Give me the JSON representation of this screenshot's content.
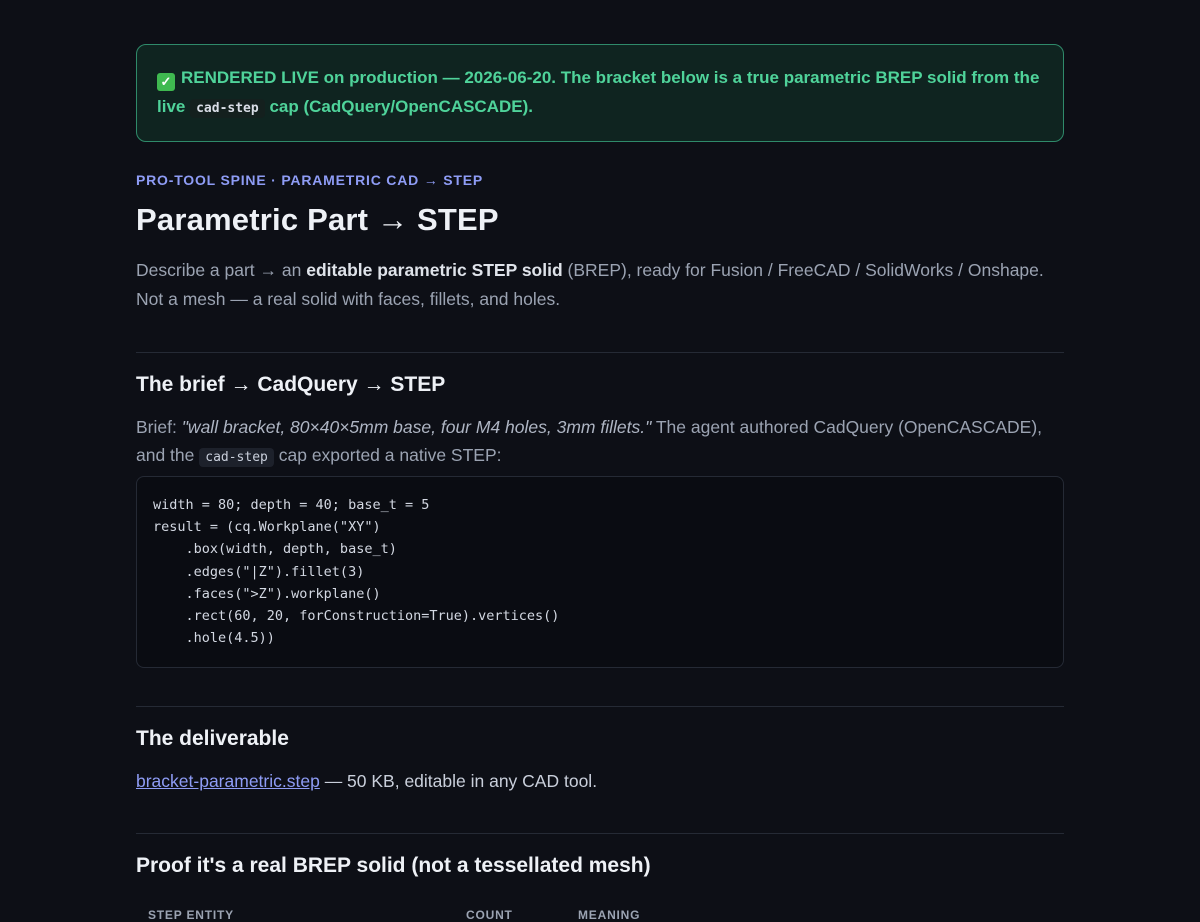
{
  "banner": {
    "icon": "check-icon",
    "text_before": "RENDERED LIVE on production — 2026-06-20. The bracket below is a true parametric BREP solid from the live ",
    "code": "cad-step",
    "text_after": " cap (CadQuery/OpenCASCADE)."
  },
  "eyebrow": "PRO-TOOL SPINE · PARAMETRIC CAD → STEP",
  "title": "Parametric Part → STEP",
  "lead": {
    "before": "Describe a part → an ",
    "bold": "editable parametric STEP solid",
    "after": " (BREP), ready for Fusion / FreeCAD / SolidWorks / Onshape. Not a mesh — a real solid with faces, fillets, and holes."
  },
  "section_brief": {
    "heading": "The brief → CadQuery → STEP",
    "brief_label": "Brief: ",
    "brief_quote": "\"wall bracket, 80×40×5mm base, four M4 holes, 3mm fillets.\"",
    "after_quote": " The agent authored CadQuery (OpenCASCADE), and the ",
    "code": "cad-step",
    "after_code": " cap exported a native STEP:",
    "code_lines": [
      "width = 80; depth = 40; base_t = 5",
      "result = (cq.Workplane(\"XY\")",
      "    .box(width, depth, base_t)",
      "    .edges(\"|Z\").fillet(3)",
      "    .faces(\">Z\").workplane()",
      "    .rect(60, 20, forConstruction=True).vertices()",
      "    .hole(4.5))"
    ]
  },
  "section_deliverable": {
    "heading": "The deliverable",
    "link": "bracket-parametric.step",
    "after_link": " — 50 KB, editable in any CAD tool."
  },
  "section_proof": {
    "heading": "Proof it's a real BREP solid (not a tessellated mesh)",
    "columns": [
      "STEP ENTITY",
      "COUNT",
      "MEANING"
    ]
  },
  "colors": {
    "background": "#0d0f16",
    "banner_green": "#4fd39a",
    "accent_blue": "#8e9cf5"
  }
}
